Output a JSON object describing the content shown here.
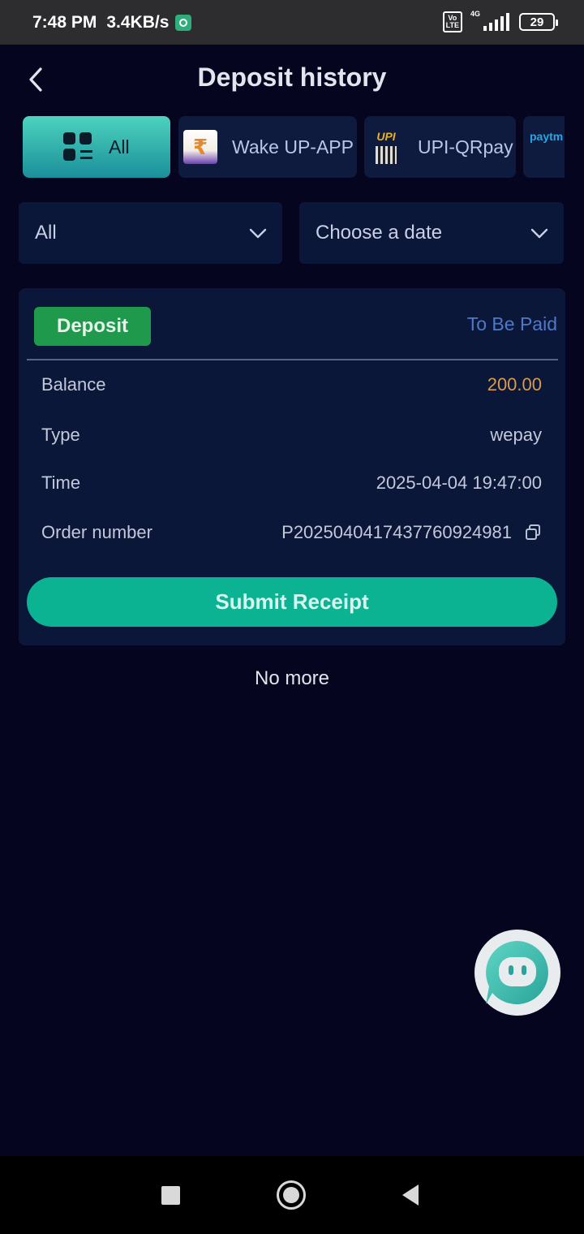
{
  "status_bar": {
    "time": "7:48 PM",
    "speed": "3.4KB/s",
    "volte": "Vo LTE",
    "network": "4G",
    "battery": "29"
  },
  "header": {
    "title": "Deposit history",
    "back_icon": "chevron-left-icon"
  },
  "tabs": [
    {
      "label": "All",
      "active": true,
      "icon": "grid-icon"
    },
    {
      "label": "Wake UP-APP",
      "active": false,
      "icon": "wake-app-logo"
    },
    {
      "label": "UPI-QRpay",
      "active": false,
      "icon": "upi-qr-logo"
    },
    {
      "label": "",
      "active": false,
      "icon": "paytm-logo"
    }
  ],
  "filters": {
    "status_select": "All",
    "date_select": "Choose a date"
  },
  "record": {
    "badge": "Deposit",
    "status": "To Be Paid",
    "rows": [
      {
        "key": "Balance",
        "value": "200.00"
      },
      {
        "key": "Type",
        "value": "wepay"
      },
      {
        "key": "Time",
        "value": "2025-04-04 19:47:00"
      },
      {
        "key": "Order number",
        "value": "P2025040417437760924981"
      }
    ],
    "submit_label": "Submit Receipt"
  },
  "footer_text": "No more",
  "colors": {
    "background": "#05051f",
    "card": "#0b1738",
    "accent": "#0bb393",
    "badge": "#1f9a4c",
    "status": "#4e79c9",
    "amount": "#d99a4a"
  }
}
